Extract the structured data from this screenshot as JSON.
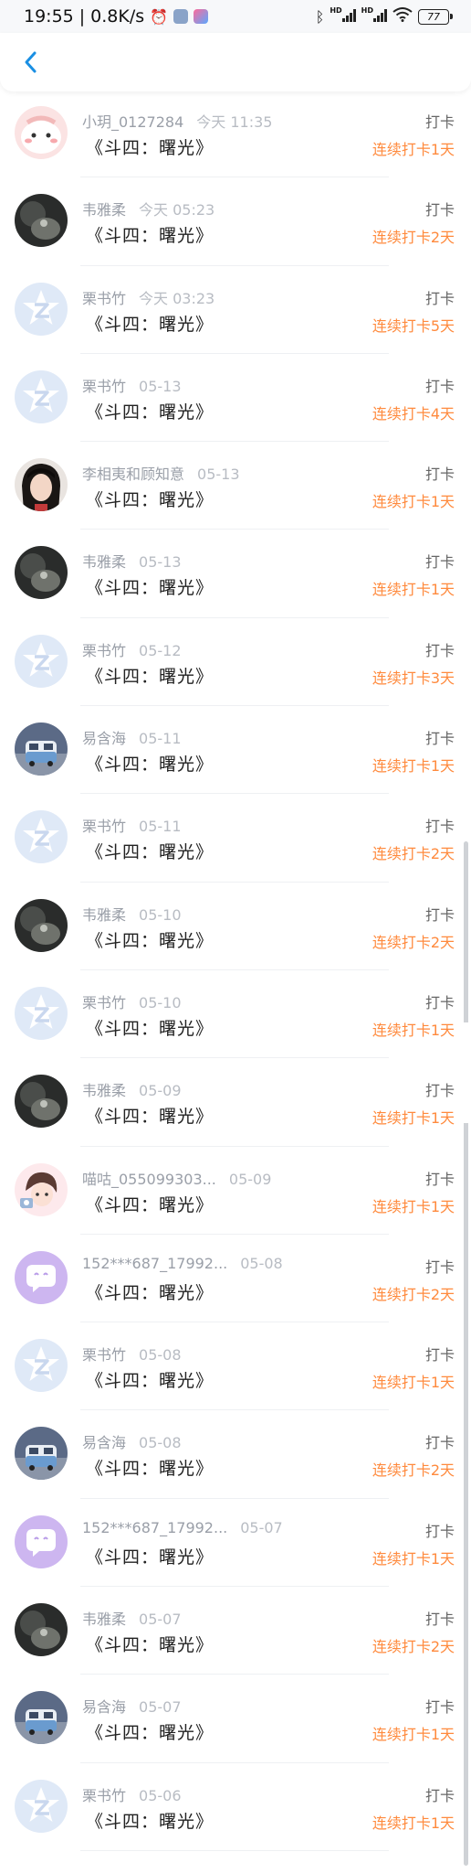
{
  "status": {
    "time": "19:55",
    "speed": "0.8K/s",
    "separator": "|",
    "battery": "77",
    "hd": "HD"
  },
  "header": {
    "back_label": "‹"
  },
  "colors": {
    "accent": "#1a8fe3",
    "streak": "#ff8a3d"
  },
  "rows": [
    {
      "name": "小玥_0127284",
      "time": "今天 11:35",
      "title": "《斗四：曙光》",
      "action": "打卡",
      "streak": "连续打卡1天",
      "avatar": "pink"
    },
    {
      "name": "韦雅柔",
      "time": "今天 05:23",
      "title": "《斗四：曙光》",
      "action": "打卡",
      "streak": "连续打卡2天",
      "avatar": "dark"
    },
    {
      "name": "栗书竹",
      "time": "今天 03:23",
      "title": "《斗四：曙光》",
      "action": "打卡",
      "streak": "连续打卡5天",
      "avatar": "star"
    },
    {
      "name": "栗书竹",
      "time": "05-13",
      "title": "《斗四：曙光》",
      "action": "打卡",
      "streak": "连续打卡4天",
      "avatar": "star"
    },
    {
      "name": "李相夷和顾知意",
      "time": "05-13",
      "title": "《斗四：曙光》",
      "action": "打卡",
      "streak": "连续打卡1天",
      "avatar": "portrait"
    },
    {
      "name": "韦雅柔",
      "time": "05-13",
      "title": "《斗四：曙光》",
      "action": "打卡",
      "streak": "连续打卡1天",
      "avatar": "dark"
    },
    {
      "name": "栗书竹",
      "time": "05-12",
      "title": "《斗四：曙光》",
      "action": "打卡",
      "streak": "连续打卡3天",
      "avatar": "star"
    },
    {
      "name": "易含海",
      "time": "05-11",
      "title": "《斗四：曙光》",
      "action": "打卡",
      "streak": "连续打卡1天",
      "avatar": "van"
    },
    {
      "name": "栗书竹",
      "time": "05-11",
      "title": "《斗四：曙光》",
      "action": "打卡",
      "streak": "连续打卡2天",
      "avatar": "star"
    },
    {
      "name": "韦雅柔",
      "time": "05-10",
      "title": "《斗四：曙光》",
      "action": "打卡",
      "streak": "连续打卡2天",
      "avatar": "dark"
    },
    {
      "name": "栗书竹",
      "time": "05-10",
      "title": "《斗四：曙光》",
      "action": "打卡",
      "streak": "连续打卡1天",
      "avatar": "star"
    },
    {
      "name": "韦雅柔",
      "time": "05-09",
      "title": "《斗四：曙光》",
      "action": "打卡",
      "streak": "连续打卡1天",
      "avatar": "dark"
    },
    {
      "name": "喵咕_055099303...",
      "time": "05-09",
      "title": "《斗四：曙光》",
      "action": "打卡",
      "streak": "连续打卡1天",
      "avatar": "girl"
    },
    {
      "name": "152***687_17992...",
      "time": "05-08",
      "title": "《斗四：曙光》",
      "action": "打卡",
      "streak": "连续打卡2天",
      "avatar": "purple"
    },
    {
      "name": "栗书竹",
      "time": "05-08",
      "title": "《斗四：曙光》",
      "action": "打卡",
      "streak": "连续打卡1天",
      "avatar": "star"
    },
    {
      "name": "易含海",
      "time": "05-08",
      "title": "《斗四：曙光》",
      "action": "打卡",
      "streak": "连续打卡2天",
      "avatar": "van"
    },
    {
      "name": "152***687_17992...",
      "time": "05-07",
      "title": "《斗四：曙光》",
      "action": "打卡",
      "streak": "连续打卡1天",
      "avatar": "purple"
    },
    {
      "name": "韦雅柔",
      "time": "05-07",
      "title": "《斗四：曙光》",
      "action": "打卡",
      "streak": "连续打卡2天",
      "avatar": "dark"
    },
    {
      "name": "易含海",
      "time": "05-07",
      "title": "《斗四：曙光》",
      "action": "打卡",
      "streak": "连续打卡1天",
      "avatar": "van"
    },
    {
      "name": "栗书竹",
      "time": "05-06",
      "title": "《斗四：曙光》",
      "action": "打卡",
      "streak": "连续打卡1天",
      "avatar": "star"
    }
  ]
}
